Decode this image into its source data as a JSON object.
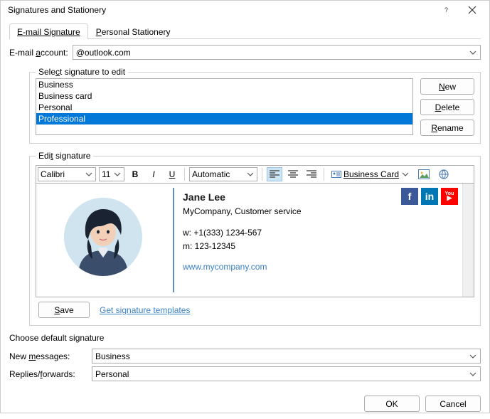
{
  "window": {
    "title": "Signatures and Stationery",
    "help_icon": "help-icon",
    "close_icon": "close-icon"
  },
  "tabs": {
    "email_sig": "E-mail Signature",
    "personal_stat": "Personal Stationery"
  },
  "account": {
    "label_pre": "E-mail ",
    "label_u": "a",
    "label_post": "ccount:",
    "value": "           @outlook.com"
  },
  "select_edit": {
    "legend_pre": "Sele",
    "legend_u": "c",
    "legend_post": "t signature to edit",
    "items": [
      "Business",
      "Business card",
      "Personal",
      "Professional"
    ],
    "selected_index": 3,
    "buttons": {
      "new_u": "N",
      "new_post": "ew",
      "delete_u": "D",
      "delete_post": "elete",
      "rename_u": "R",
      "rename_post": "ename"
    }
  },
  "edit_sig": {
    "legend_pre": "Edi",
    "legend_u": "t",
    "legend_post": " signature",
    "toolbar": {
      "font": "Calibri",
      "size": "11",
      "bold": "B",
      "italic": "I",
      "underline": "U",
      "color": "Automatic",
      "biz_card_label": "Business Card"
    },
    "content": {
      "name": "Jane Lee",
      "company": "MyCompany, Customer service",
      "phone_w_label": "w: ",
      "phone_w": "+1(333) 1234-567",
      "phone_m_label": "m: ",
      "phone_m": "123-12345",
      "url": "www.mycompany.com"
    },
    "save_u": "S",
    "save_post": "ave",
    "templates_link": "Get signature templates"
  },
  "defaults": {
    "legend": "Choose default signature",
    "new_msg_label_pre": "New ",
    "new_msg_label_u": "m",
    "new_msg_label_post": "essages:",
    "new_msg_value": "Business",
    "replies_label_pre": "Replies/",
    "replies_label_u": "f",
    "replies_label_post": "orwards:",
    "replies_value": "Personal"
  },
  "footer": {
    "ok": "OK",
    "cancel": "Cancel"
  }
}
